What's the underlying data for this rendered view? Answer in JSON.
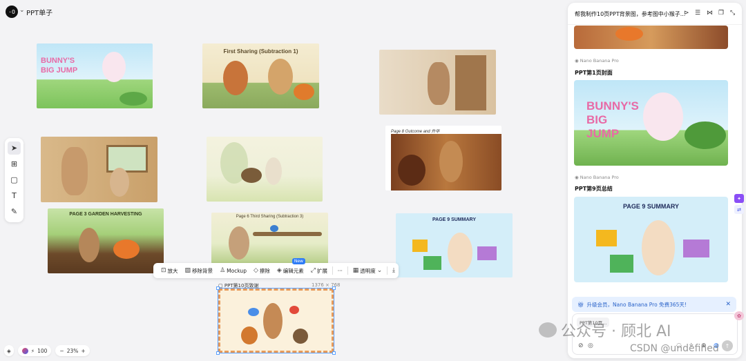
{
  "app": {
    "project_title": "PPT单子"
  },
  "canvas": {
    "images": [
      {
        "id": "bunny-big-jump",
        "text": "BUNNY'S BIG JUMP"
      },
      {
        "id": "first-sharing",
        "text": "First Sharing (Subtraction 1)"
      },
      {
        "id": "bunny-door",
        "text": ""
      },
      {
        "id": "bunny-kitchen",
        "text": ""
      },
      {
        "id": "bunny-hedgehog",
        "text": ""
      },
      {
        "id": "page8-outcome",
        "text": "Page 8  Outcome and 升华"
      },
      {
        "id": "page3-garden",
        "text": "PAGE 3 GARDEN HARVESTING"
      },
      {
        "id": "page6-third-sharing",
        "text": "Page 6  Third Sharing (Subtraction 3)"
      },
      {
        "id": "page9-summary",
        "text": "PAGE 9 SUMMARY"
      },
      {
        "id": "page10-ending",
        "text": ""
      }
    ],
    "selected": {
      "label": "PPT第10页致谢",
      "size": "1376 × 768"
    }
  },
  "toolbar": {
    "items": [
      {
        "label": "放大",
        "icon": "upscale-icon"
      },
      {
        "label": "移除背景",
        "icon": "remove-bg-icon"
      },
      {
        "label": "Mockup",
        "icon": "shirt-icon"
      },
      {
        "label": "擦除",
        "icon": "eraser-icon"
      },
      {
        "label": "编辑元素",
        "icon": "layers-icon",
        "badge": "New"
      },
      {
        "label": "扩展",
        "icon": "expand-icon"
      },
      {
        "label": "透明度",
        "icon": "opacity-icon"
      }
    ],
    "more": "···"
  },
  "bottom": {
    "credits": "100",
    "zoom": "23%",
    "zoom_minus": "−",
    "zoom_plus": "+"
  },
  "panel": {
    "title": "帮我制作10页PPT背景图，参考图中小猴子...",
    "model": "Nano Banana Pro",
    "section1": "PPT第1页封面",
    "section2": "PPT第9页总结",
    "model2": "Nano Banana Pro",
    "upgrade_text": "升级会员，Nano Banana Pro 免费365天!",
    "chip": "PPT第10页..."
  },
  "watermark": {
    "text": "公众号 · 顾北 AI",
    "csdn": "CSDN @undefined"
  },
  "colors": {
    "accent": "#2f7cf6",
    "selection": "#5aa0ff",
    "upgrade_bg": "#e6f0ff"
  }
}
